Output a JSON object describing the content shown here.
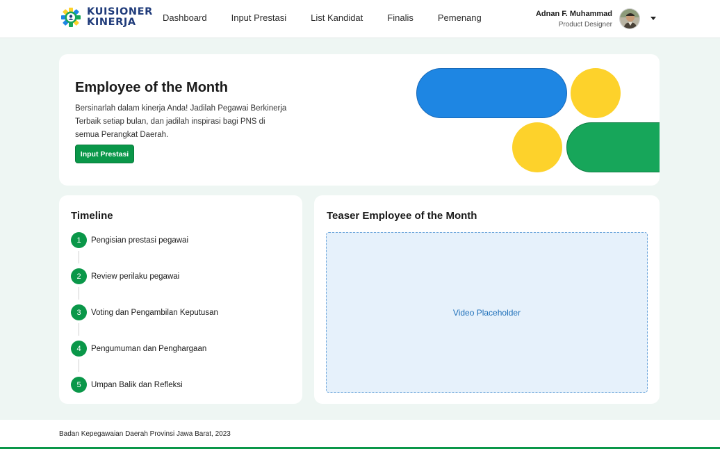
{
  "brand": {
    "line1": "KUISIONER",
    "line2": "KINERJA"
  },
  "nav": {
    "links": [
      "Dashboard",
      "Input Prestasi",
      "List Kandidat",
      "Finalis",
      "Pemenang"
    ]
  },
  "user": {
    "name": "Adnan F. Muhammad",
    "role": "Product Designer"
  },
  "hero": {
    "title": "Employee of the Month",
    "description": "Bersinarlah dalam kinerja Anda! Jadilah Pegawai Berkinerja Terbaik setiap bulan, dan jadilah inspirasi bagi PNS di semua Perangkat Daerah.",
    "button_label": "Input Prestasi"
  },
  "timeline": {
    "title": "Timeline",
    "steps": [
      {
        "number": "1",
        "label": "Pengisian prestasi pegawai"
      },
      {
        "number": "2",
        "label": "Review perilaku pegawai"
      },
      {
        "number": "3",
        "label": "Voting dan Pengambilan Keputusan"
      },
      {
        "number": "4",
        "label": "Pengumuman dan Penghargaan"
      },
      {
        "number": "5",
        "label": "Umpan Balik dan Refleksi"
      }
    ]
  },
  "teaser": {
    "title": "Teaser Employee of the Month",
    "video_placeholder": "Video Placeholder"
  },
  "footer": {
    "text": "Badan Kepegawaian Daerah Provinsi Jawa Barat, 2023"
  },
  "colors": {
    "primary_green": "#0a9749",
    "brand_navy": "#1f3b7a",
    "accent_blue": "#1e86e3",
    "accent_yellow": "#fdd22b",
    "background": "#eef6f3"
  },
  "icons": {
    "logo": "gear-logo-icon",
    "avatar": "user-avatar",
    "dropdown": "caret-down-icon"
  }
}
